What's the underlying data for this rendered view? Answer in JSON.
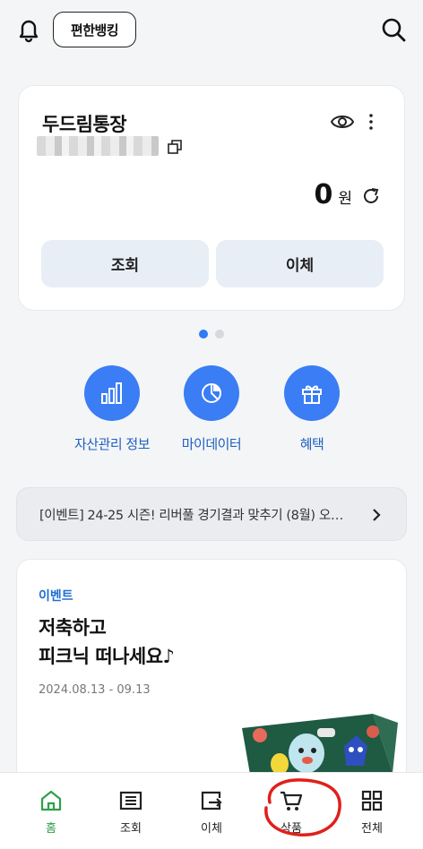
{
  "header": {
    "easy_banking_label": "편한뱅킹",
    "bell_icon": "bell-icon",
    "search_icon": "search-icon"
  },
  "account_card": {
    "name": "두드림통장",
    "balance": "0",
    "currency_unit": "원",
    "inquiry_label": "조회",
    "transfer_label": "이체"
  },
  "pagination": {
    "current": 1,
    "total": 2
  },
  "quick_menu": [
    {
      "label": "자산관리 정보",
      "icon": "bar-chart-icon"
    },
    {
      "label": "마이데이터",
      "icon": "pie-chart-icon"
    },
    {
      "label": "혜택",
      "icon": "gift-icon"
    }
  ],
  "event_banner": {
    "text": "[이벤트] 24-25 시즌! 리버풀 경기결과 맞추기 (8월) 오…"
  },
  "promo": {
    "tag": "이벤트",
    "title_line1": "저축하고",
    "title_line2": "피크닉 떠나세요♪",
    "date_range": "2024.08.13 - 09.13"
  },
  "tabbar": [
    {
      "label": "홈",
      "icon": "home-icon",
      "active": true
    },
    {
      "label": "조회",
      "icon": "list-icon",
      "active": false
    },
    {
      "label": "이체",
      "icon": "transfer-icon",
      "active": false
    },
    {
      "label": "상품",
      "icon": "cart-icon",
      "active": false
    },
    {
      "label": "전체",
      "icon": "grid-icon",
      "active": false
    }
  ],
  "colors": {
    "accent_blue": "#3a7df5",
    "active_green": "#2ea04a",
    "annotation_red": "#e0201b"
  }
}
